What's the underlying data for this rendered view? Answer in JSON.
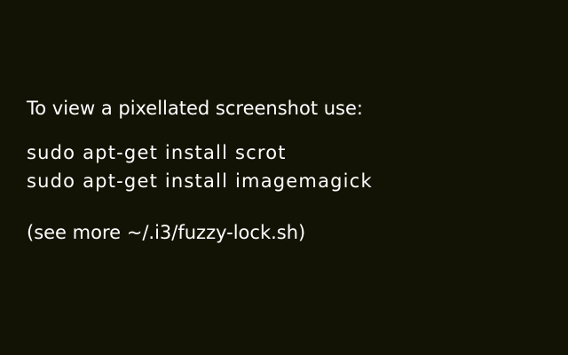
{
  "lockscreen": {
    "background_color": "#131305",
    "text_color": "#ffffff",
    "heading": "To view a pixellated screenshot use:",
    "commands": [
      "sudo apt-get install scrot",
      "sudo apt-get install imagemagick"
    ],
    "note": "(see more ~/.i3/fuzzy-lock.sh)"
  }
}
